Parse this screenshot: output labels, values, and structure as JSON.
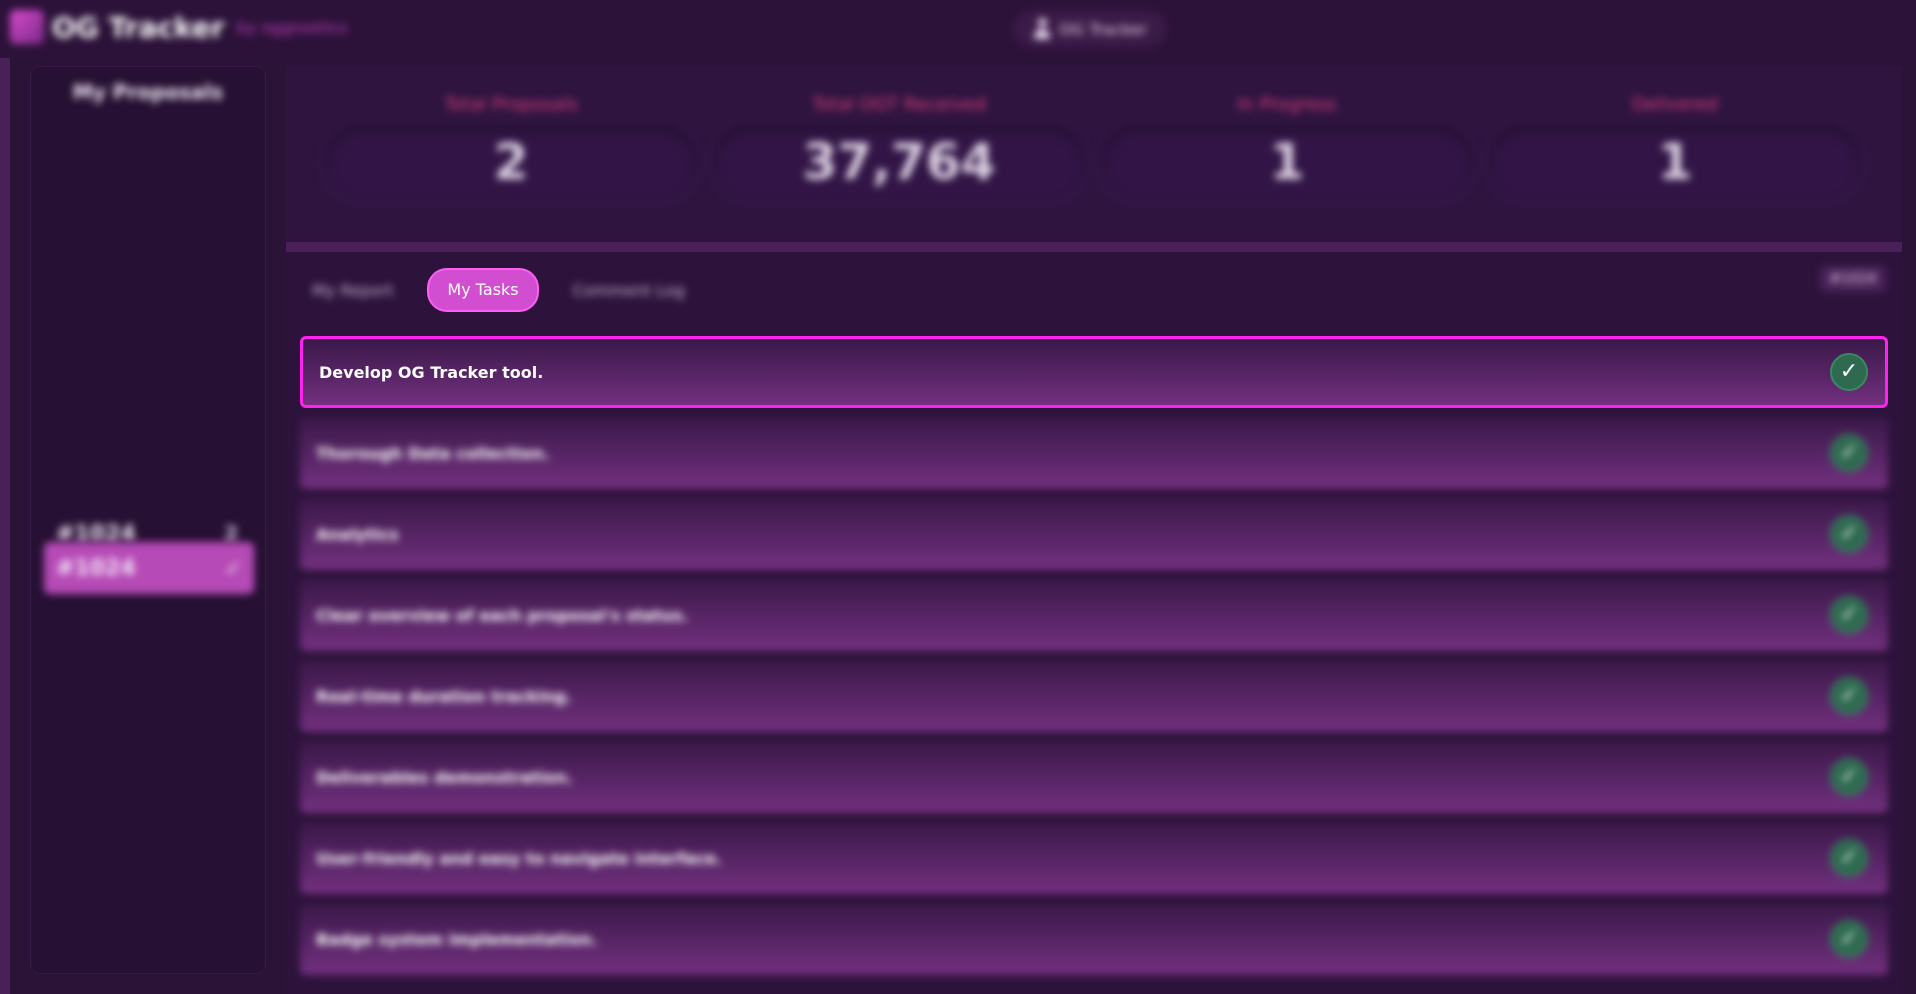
{
  "header": {
    "app_title": "OG Tracker",
    "app_subtitle": "by oggnostics",
    "user_label": "OG Tracker"
  },
  "sidebar": {
    "title": "My Proposals",
    "items": [
      {
        "id": "#1024",
        "count": "2",
        "selected": false
      },
      {
        "id": "#1024",
        "check": "✓",
        "selected": true
      }
    ]
  },
  "stats": [
    {
      "label": "Total Proposals",
      "value": "2"
    },
    {
      "label": "Total OGT Received",
      "value": "37,764"
    },
    {
      "label": "In Progress",
      "value": "1"
    },
    {
      "label": "Delivered",
      "value": "1"
    }
  ],
  "tabs": [
    {
      "label": "My Report",
      "active": false
    },
    {
      "label": "My Tasks",
      "active": true
    },
    {
      "label": "Comment Log",
      "active": false
    }
  ],
  "proposal_badge": "#1024",
  "tasks": [
    {
      "text": "Develop OG Tracker tool.",
      "done": true,
      "check": "✓"
    },
    {
      "text": "Thorough Data collection.",
      "done": true,
      "check": "✓"
    },
    {
      "text": "Analytics",
      "done": true,
      "check": "✓"
    },
    {
      "text": "Clear overview of each proposal's status.",
      "done": true,
      "check": "✓"
    },
    {
      "text": "Real-time duration tracking.",
      "done": true,
      "check": "✓"
    },
    {
      "text": "Deliverables demonstration.",
      "done": true,
      "check": "✓"
    },
    {
      "text": "User-friendly and easy to navigate interface.",
      "done": true,
      "check": "✓"
    },
    {
      "text": "Badge system implementation.",
      "done": true,
      "check": "✓"
    }
  ],
  "colors": {
    "accent": "#d24ed0",
    "active_border": "#ff22f0",
    "stat_label": "#d8407a",
    "check_bg": "#2d6a4f"
  }
}
